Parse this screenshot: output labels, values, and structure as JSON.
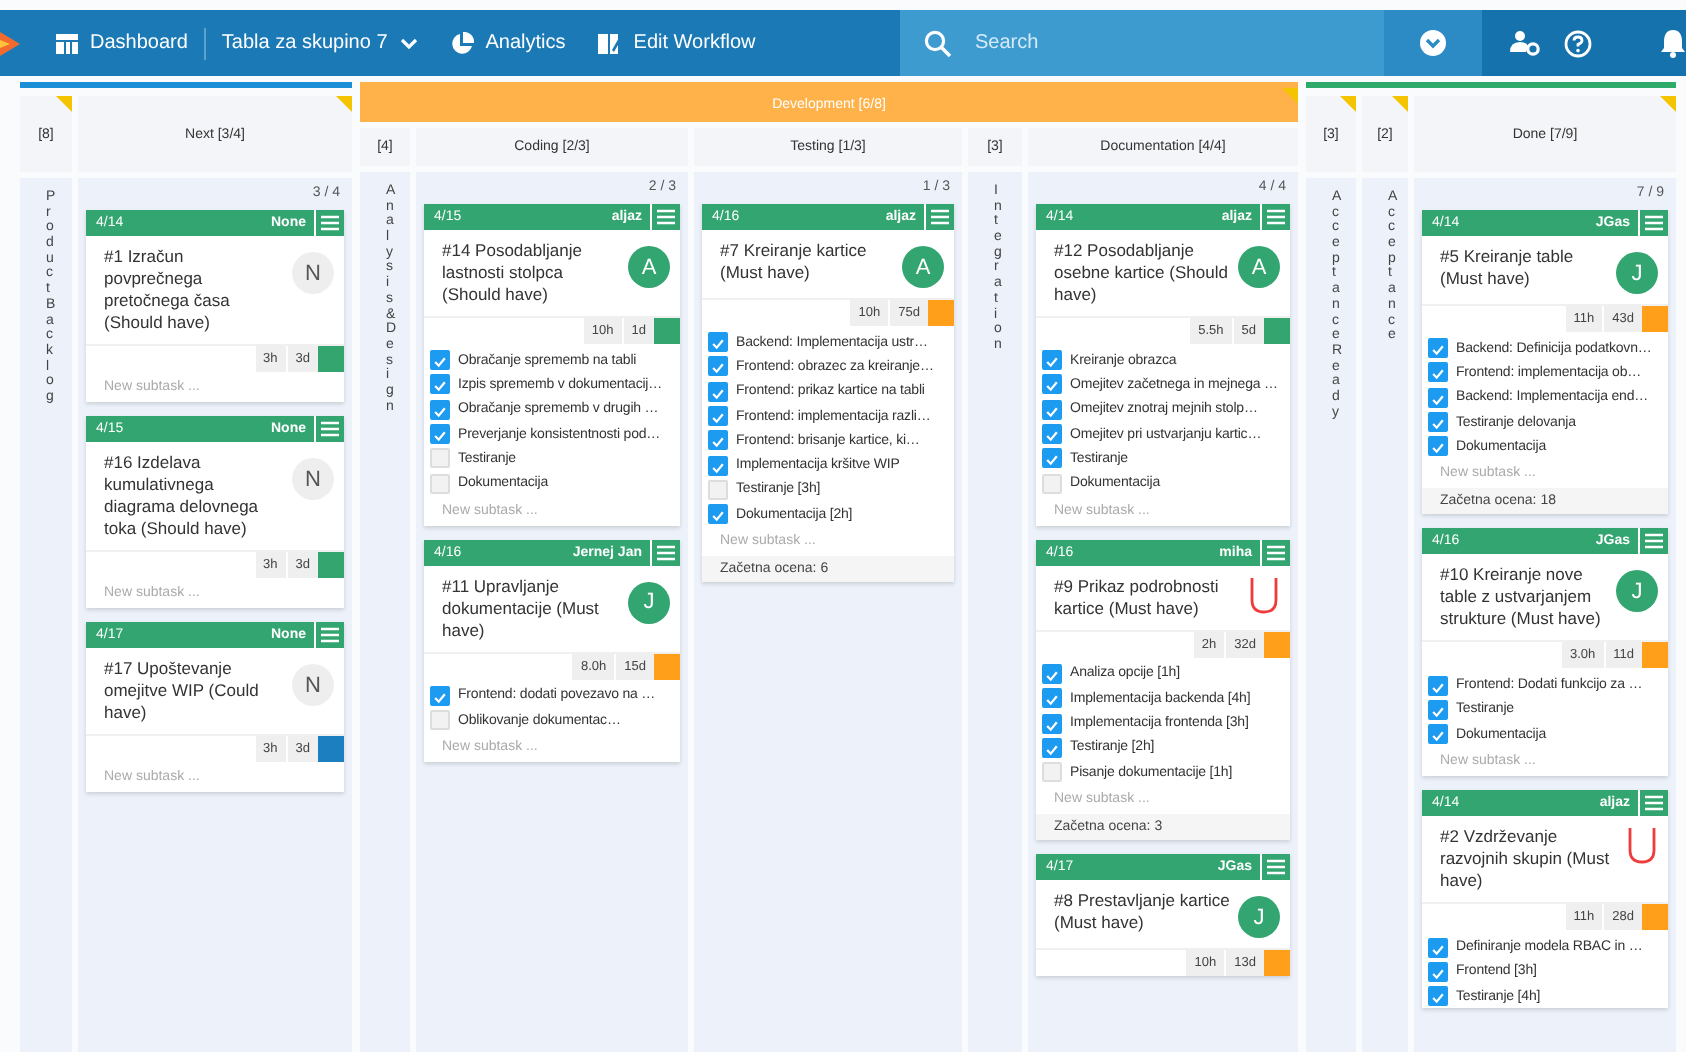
{
  "navbar": {
    "items": [
      {
        "kind": "dashboard",
        "label": "Dashboard"
      },
      {
        "kind": "board",
        "label": "Tabla za skupino 7"
      },
      {
        "kind": "analytics",
        "label": "Analytics"
      },
      {
        "kind": "workflow",
        "label": "Edit Workflow"
      }
    ],
    "search": {
      "placeholder": "Search"
    }
  },
  "groups": [
    {
      "color": "#1a8fd6",
      "columns": [
        {
          "kind": "collapsed",
          "limit": "[8]",
          "title": "Product Backlog",
          "flagged": true
        },
        {
          "kind": "expanded",
          "title": "Next [3/4]",
          "count": "3 / 4",
          "flagged": true,
          "cards": [
            {
              "date": "4/14",
              "owner": "None",
              "title": "#1 Izračun povprečnega pretočnega časa (Should have)",
              "avatar": {
                "kind": "letter",
                "text": "N",
                "filled": false
              },
              "times": [
                "3h",
                "3d"
              ],
              "color": "#35a56f",
              "placeholder": "New subtask ..."
            },
            {
              "date": "4/15",
              "owner": "None",
              "title": "#16 Izdelava kumulativnega diagrama delovnega toka (Should have)",
              "avatar": {
                "kind": "letter",
                "text": "N",
                "filled": false
              },
              "times": [
                "3h",
                "3d"
              ],
              "color": "#35a56f",
              "placeholder": "New subtask ..."
            },
            {
              "date": "4/17",
              "owner": "None",
              "title": "#17 Upoštevanje omejitve WIP (Could have)",
              "avatar": {
                "kind": "letter",
                "text": "N",
                "filled": false
              },
              "times": [
                "3h",
                "3d"
              ],
              "color": "#1c7fc0",
              "placeholder": "New subtask ..."
            }
          ]
        }
      ]
    },
    {
      "color": "#ffb24a",
      "title": "Development [6/8]",
      "flagged": true,
      "columns": [
        {
          "kind": "collapsed",
          "limit": "[4]",
          "title": "Analysis & Design",
          "flagged": false
        },
        {
          "kind": "expanded",
          "title": "Coding [2/3]",
          "count": "2 / 3",
          "flagged": false,
          "cards": [
            {
              "date": "4/15",
              "owner": "aljaz",
              "title": "#14 Posodabljanje lastnosti stolpca (Should have)",
              "avatar": {
                "kind": "letter",
                "text": "A",
                "filled": true
              },
              "times": [
                "10h",
                "1d"
              ],
              "color": "#35a56f",
              "subtasks": [
                {
                  "text": "Obračanje sprememb na tabli",
                  "checked": true
                },
                {
                  "text": "Izpis sprememb v dokumentacij…",
                  "checked": true
                },
                {
                  "text": "Obračanje sprememb v drugih …",
                  "checked": true
                },
                {
                  "text": "Preverjanje konsistentnosti pod…",
                  "checked": true
                },
                {
                  "text": "Testiranje",
                  "checked": false
                },
                {
                  "text": "Dokumentacija",
                  "checked": false
                }
              ],
              "placeholder": "New subtask ..."
            },
            {
              "date": "4/16",
              "owner": "Jernej Jan",
              "title": "#11 Upravljanje dokumentacije (Must have)",
              "avatar": {
                "kind": "letter",
                "text": "J",
                "filled": true
              },
              "times": [
                "8.0h",
                "15d"
              ],
              "color": "#ff9f1a",
              "subtasks": [
                {
                  "text": "Frontend: dodati povezavo na …",
                  "checked": true
                },
                {
                  "text": "Oblikovanje dokumentac…",
                  "checked": false
                }
              ],
              "placeholder": "New subtask ..."
            }
          ]
        },
        {
          "kind": "expanded",
          "title": "Testing [1/3]",
          "count": "1 / 3",
          "flagged": false,
          "cards": [
            {
              "date": "4/16",
              "owner": "aljaz",
              "title": "#7 Kreiranje kartice (Must have)",
              "avatar": {
                "kind": "letter",
                "text": "A",
                "filled": true
              },
              "times": [
                "10h",
                "75d"
              ],
              "color": "#ff9f1a",
              "subtasks": [
                {
                  "text": "Backend: Implementacija ustr…",
                  "checked": true
                },
                {
                  "text": "Frontend: obrazec za kreiranje…",
                  "checked": true
                },
                {
                  "text": "Frontend: prikaz kartice na tabli",
                  "checked": true
                },
                {
                  "text": "Frontend: implementacija razli…",
                  "checked": true
                },
                {
                  "text": "Frontend: brisanje kartice, ki…",
                  "checked": true
                },
                {
                  "text": "Implementacija kršitve WIP",
                  "checked": true
                },
                {
                  "text": "Testiranje [3h]",
                  "checked": false
                },
                {
                  "text": "Dokumentacija [2h]",
                  "checked": true
                }
              ],
              "placeholder": "New subtask ...",
              "footer": "Začetna ocena: 6"
            }
          ]
        },
        {
          "kind": "collapsed",
          "limit": "[3]",
          "title": "Integration",
          "flagged": false
        },
        {
          "kind": "expanded",
          "title": "Documentation [4/4]",
          "count": "4 / 4",
          "flagged": false,
          "cards": [
            {
              "date": "4/14",
              "owner": "aljaz",
              "title": "#12 Posodabljanje osebne kartice (Should have)",
              "avatar": {
                "kind": "letter",
                "text": "A",
                "filled": true
              },
              "times": [
                "5.5h",
                "5d"
              ],
              "color": "#35a56f",
              "subtasks": [
                {
                  "text": "Kreiranje obrazca",
                  "checked": true
                },
                {
                  "text": "Omejitev začetnega in mejnega …",
                  "checked": true
                },
                {
                  "text": "Omejitev znotraj mejnih stolp…",
                  "checked": true
                },
                {
                  "text": "Omejitev pri ustvarjanju kartic…",
                  "checked": true
                },
                {
                  "text": "Testiranje",
                  "checked": true
                },
                {
                  "text": "Dokumentacija",
                  "checked": false
                }
              ],
              "placeholder": "New subtask ..."
            },
            {
              "date": "4/16",
              "owner": "miha",
              "title": "#9 Prikaz podrobnosti kartice (Must have)",
              "avatar": {
                "kind": "icon"
              },
              "times": [
                "2h",
                "32d"
              ],
              "color": "#ff9f1a",
              "subtasks": [
                {
                  "text": "Analiza opcije [1h]",
                  "checked": true
                },
                {
                  "text": "Implementacija backenda [4h]",
                  "checked": true
                },
                {
                  "text": "Implementacija frontenda [3h]",
                  "checked": true
                },
                {
                  "text": "Testiranje [2h]",
                  "checked": true
                },
                {
                  "text": "Pisanje dokumentacije [1h]",
                  "checked": false
                }
              ],
              "placeholder": "New subtask ...",
              "footer": "Začetna ocena: 3"
            },
            {
              "date": "4/17",
              "owner": "JGas",
              "title": "#8 Prestavljanje kartice (Must have)",
              "avatar": {
                "kind": "letter",
                "text": "J",
                "filled": true
              },
              "times": [
                "10h",
                "13d"
              ],
              "color": "#ff9f1a"
            }
          ]
        }
      ]
    },
    {
      "color": "#2eaa6a",
      "columns": [
        {
          "kind": "collapsed",
          "limit": "[3]",
          "title": "Acceptance Ready",
          "flagged": true
        },
        {
          "kind": "collapsed",
          "limit": "[2]",
          "title": "Acceptance",
          "flagged": true
        },
        {
          "kind": "expanded",
          "title": "Done [7/9]",
          "count": "7 / 9",
          "flagged": true,
          "cards": [
            {
              "date": "4/14",
              "owner": "JGas",
              "title": "#5 Kreiranje table (Must have)",
              "avatar": {
                "kind": "letter",
                "text": "J",
                "filled": true
              },
              "times": [
                "11h",
                "43d"
              ],
              "color": "#ff9f1a",
              "subtasks": [
                {
                  "text": "Backend: Definicija podatkovn…",
                  "checked": true
                },
                {
                  "text": "Frontend: implementacija ob…",
                  "checked": true
                },
                {
                  "text": "Backend: Implementacija end…",
                  "checked": true
                },
                {
                  "text": "Testiranje delovanja",
                  "checked": true
                },
                {
                  "text": "Dokumentacija",
                  "checked": true
                }
              ],
              "placeholder": "New subtask ...",
              "footer": "Začetna ocena: 18"
            },
            {
              "date": "4/16",
              "owner": "JGas",
              "title": "#10 Kreiranje nove table z ustvarjanjem strukture (Must have)",
              "avatar": {
                "kind": "letter",
                "text": "J",
                "filled": true
              },
              "times": [
                "3.0h",
                "11d"
              ],
              "color": "#ff9f1a",
              "subtasks": [
                {
                  "text": "Frontend: Dodati funkcijo za …",
                  "checked": true
                },
                {
                  "text": "Testiranje",
                  "checked": true
                },
                {
                  "text": "Dokumentacija",
                  "checked": true
                }
              ],
              "placeholder": "New subtask ..."
            },
            {
              "date": "4/14",
              "owner": "aljaz",
              "title": "#2 Vzdrževanje razvojnih skupin (Must have)",
              "avatar": {
                "kind": "icon"
              },
              "times": [
                "11h",
                "28d"
              ],
              "color": "#ff9f1a",
              "subtasks": [
                {
                  "text": "Definiranje modela RBAC in …",
                  "checked": true
                },
                {
                  "text": "Frontend [3h]",
                  "checked": true
                },
                {
                  "text": "Testiranje [4h]",
                  "checked": true
                }
              ]
            }
          ]
        }
      ]
    }
  ]
}
